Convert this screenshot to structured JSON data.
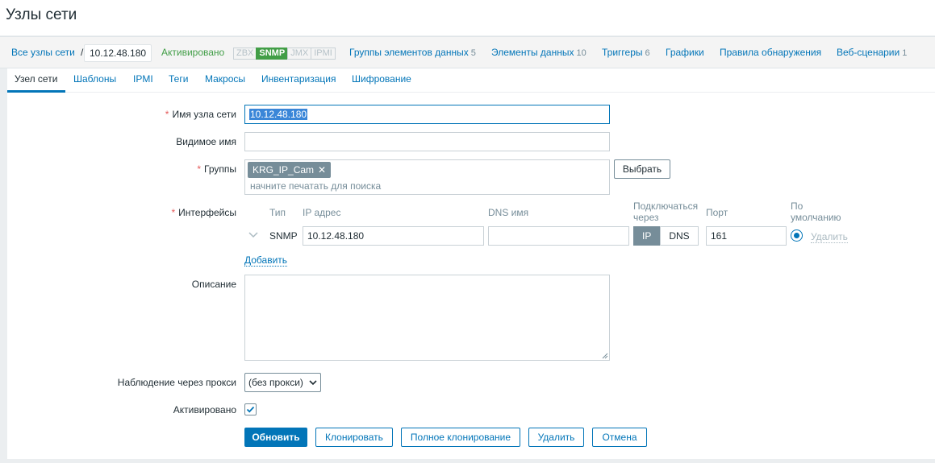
{
  "page": {
    "title": "Узлы сети"
  },
  "nav": {
    "all_hosts": "Все узлы сети",
    "separator": "/",
    "current_host": "10.12.48.180",
    "status": "Активировано",
    "availability": [
      "ZBX",
      "SNMP",
      "JMX",
      "IPMI"
    ],
    "active_availability": "SNMP",
    "links": [
      {
        "label": "Группы элементов данных",
        "count": "5"
      },
      {
        "label": "Элементы данных",
        "count": "10"
      },
      {
        "label": "Триггеры",
        "count": "6"
      },
      {
        "label": "Графики",
        "count": ""
      },
      {
        "label": "Правила обнаружения",
        "count": ""
      },
      {
        "label": "Веб-сценарии",
        "count": "1"
      }
    ]
  },
  "tabs": [
    "Узел сети",
    "Шаблоны",
    "IPMI",
    "Теги",
    "Макросы",
    "Инвентаризация",
    "Шифрование"
  ],
  "active_tab": "Узел сети",
  "form": {
    "host_name_label": "Имя узла сети",
    "host_name_value": "10.12.48.180",
    "visible_name_label": "Видимое имя",
    "visible_name_value": "",
    "groups_label": "Группы",
    "group_chip": "KRG_IP_Cam",
    "group_chip_remove": "✕",
    "groups_placeholder": "начните печатать для поиска",
    "select_button": "Выбрать",
    "interfaces_label": "Интерфейсы",
    "interface_cols": {
      "type": "Тип",
      "ip": "IP адрес",
      "dns": "DNS имя",
      "connect_line1": "Подключаться",
      "connect_line2": "через",
      "port": "Порт",
      "default_line1": "По",
      "default_line2": "умолчанию"
    },
    "interface": {
      "type": "SNMP",
      "ip": "10.12.48.180",
      "dns": "",
      "connect_ip": "IP",
      "connect_dns": "DNS",
      "connect_selected": "IP",
      "port": "161",
      "remove": "Удалить"
    },
    "add_link": "Добавить",
    "description_label": "Описание",
    "description_value": "",
    "proxy_label": "Наблюдение через прокси",
    "proxy_value": "(без прокси)",
    "enabled_label": "Активировано",
    "enabled_checked": true,
    "required_mark": "*"
  },
  "buttons": {
    "update": "Обновить",
    "clone": "Клонировать",
    "full_clone": "Полное клонирование",
    "delete": "Удалить",
    "cancel": "Отмена"
  }
}
